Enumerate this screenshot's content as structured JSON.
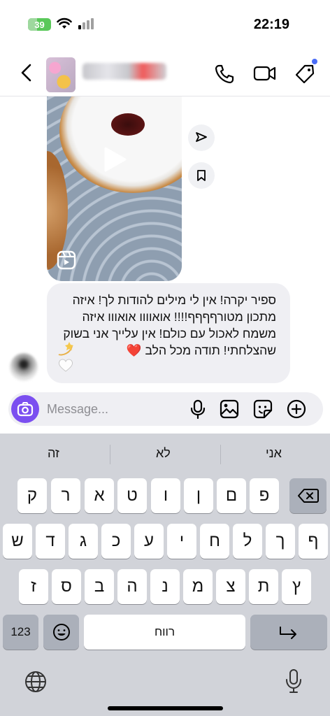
{
  "status_bar": {
    "battery": "39",
    "time": "22:19"
  },
  "header": {
    "tag_notification_color": "#4a6cf7"
  },
  "message": {
    "text": "ספיר יקרה! אין לי מילים להודות לך! איזה מתכון מטורףףףף!!!! אואוווו אואווו איזה משמח לאכול עם כולם! אין עלייך אני בשוק שהצלחתי! תודה מכל הלב ❤️",
    "emoji": "💫🤍"
  },
  "composer": {
    "placeholder": "Message..."
  },
  "keyboard": {
    "suggestions": [
      "זה",
      "לא",
      "אני"
    ],
    "row1": [
      "ק",
      "ר",
      "א",
      "ט",
      "ו",
      "ן",
      "ם",
      "פ"
    ],
    "row2": [
      "ש",
      "ד",
      "ג",
      "כ",
      "ע",
      "י",
      "ח",
      "ל",
      "ך",
      "ף"
    ],
    "row3": [
      "ז",
      "ס",
      "ב",
      "ה",
      "נ",
      "מ",
      "צ",
      "ת",
      "ץ"
    ],
    "numbers_label": "123",
    "space_label": "רווח"
  },
  "colors": {
    "accent": "#7b4ff0",
    "bubble": "#efeff3",
    "keyboard_bg": "#d1d3d9"
  }
}
